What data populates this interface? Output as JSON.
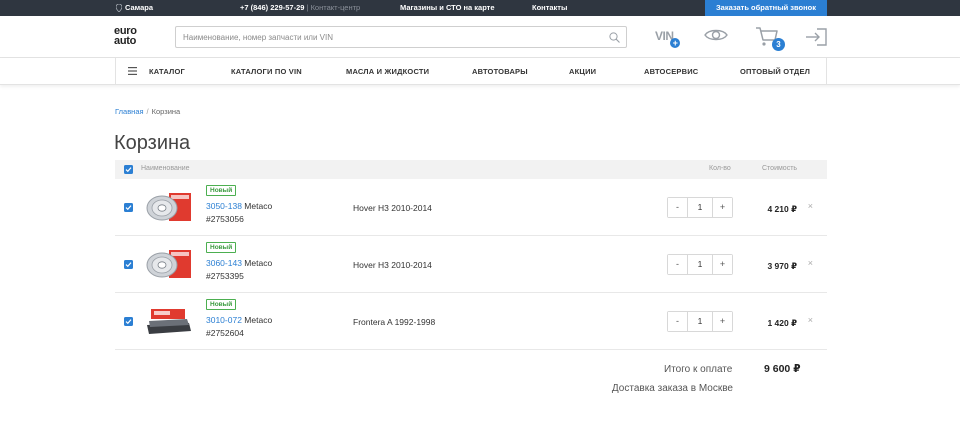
{
  "topbar": {
    "city": "Самара",
    "phone": "+7 (846) 229-57-29",
    "phone_sep": "|",
    "contact_center": "Контакт-центр",
    "stores": "Магазины и СТО на карте",
    "contacts": "Контакты",
    "callback": "Заказать обратный звонок"
  },
  "header": {
    "logo_line1": "euro",
    "logo_line2": "auto",
    "search_placeholder": "Наименование, номер запчасти или VIN",
    "vin_label": "VIN",
    "vin_plus": "+",
    "cart_count": "3"
  },
  "nav": {
    "items": [
      "КАТАЛОГ",
      "КАТАЛОГИ ПО VIN",
      "МАСЛА И ЖИДКОСТИ",
      "АВТОТОВАРЫ",
      "АКЦИИ",
      "АВТОСЕРВИС",
      "ОПТОВЫЙ ОТДЕЛ"
    ]
  },
  "breadcrumb": {
    "home": "Главная",
    "sep": "/",
    "current": "Корзина"
  },
  "page_title": "Корзина",
  "table": {
    "col_name": "Наименование",
    "col_qty": "Кол-во",
    "col_price": "Стоимость",
    "rows": [
      {
        "badge": "Новый",
        "code": "3050-138",
        "brand": "Metaco",
        "sku": "#2753056",
        "model": "Hover H3 2010-2014",
        "qty": "1",
        "price": "4 210 ₽",
        "thumb": "brake-disc"
      },
      {
        "badge": "Новый",
        "code": "3060-143",
        "brand": "Metaco",
        "sku": "#2753395",
        "model": "Hover H3 2010-2014",
        "qty": "1",
        "price": "3 970 ₽",
        "thumb": "brake-disc"
      },
      {
        "badge": "Новый",
        "code": "3010-072",
        "brand": "Metaco",
        "sku": "#2752604",
        "model": "Frontera A 1992-1998",
        "qty": "1",
        "price": "1 420 ₽",
        "thumb": "brake-pads"
      }
    ],
    "minus": "-",
    "plus": "+",
    "remove": "×"
  },
  "totals": {
    "label": "Итого к оплате",
    "value": "9 600 ₽",
    "delivery": "Доставка заказа в Москве"
  },
  "colors": {
    "accent": "#2b7fd3",
    "topbar_bg": "#2f3640",
    "badge_green": "#4caf50",
    "brand_red": "#e03a2f"
  }
}
